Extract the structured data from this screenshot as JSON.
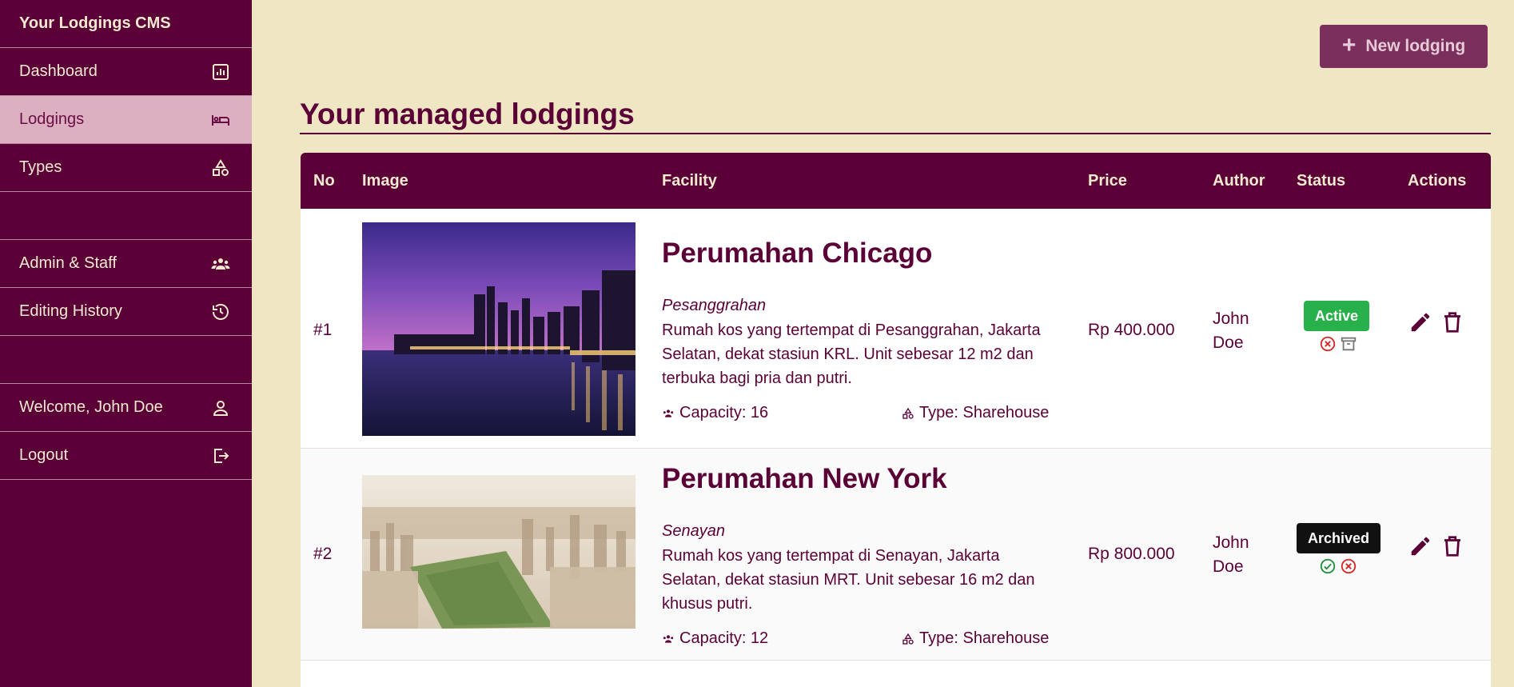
{
  "sidebar": {
    "brand": "Your Lodgings CMS",
    "items": [
      {
        "label": "Dashboard",
        "icon": "chart-icon"
      },
      {
        "label": "Lodgings",
        "icon": "bed-icon",
        "active": true
      },
      {
        "label": "Types",
        "icon": "shapes-icon"
      },
      {
        "label": "Admin & Staff",
        "icon": "users-icon"
      },
      {
        "label": "Editing History",
        "icon": "history-icon"
      },
      {
        "label": "Welcome, John Doe",
        "icon": "user-icon"
      },
      {
        "label": "Logout",
        "icon": "logout-icon"
      }
    ]
  },
  "header": {
    "new_button": "New lodging",
    "page_title": "Your managed lodgings"
  },
  "table": {
    "columns": [
      "No",
      "Image",
      "Facility",
      "Price",
      "Author",
      "Status",
      "Actions"
    ],
    "rows": [
      {
        "no": "#1",
        "title": "Perumahan Chicago",
        "location": "Pesanggrahan",
        "description": "Rumah kos yang tertempat di Pesanggrahan, Jakarta Selatan, dekat stasiun KRL. Unit sebesar 12 m2 dan terbuka bagi pria dan putri.",
        "capacity": "Capacity: 16",
        "type": "Type: Sharehouse",
        "price": "Rp 400.000",
        "author": "John Doe",
        "status": "Active"
      },
      {
        "no": "#2",
        "title": "Perumahan New York",
        "location": "Senayan",
        "description": "Rumah kos yang tertempat di Senayan, Jakarta Selatan, dekat stasiun MRT. Unit sebesar 16 m2 dan khusus putri.",
        "capacity": "Capacity: 12",
        "type": "Type: Sharehouse",
        "price": "Rp 800.000",
        "author": "John Doe",
        "status": "Archived"
      }
    ]
  },
  "colors": {
    "primary": "#5a0036",
    "background": "#efe6c4",
    "active_nav": "#dcb0c0",
    "active_badge": "#28b14b",
    "archived_badge": "#111111",
    "new_button": "#7a2f5d"
  }
}
